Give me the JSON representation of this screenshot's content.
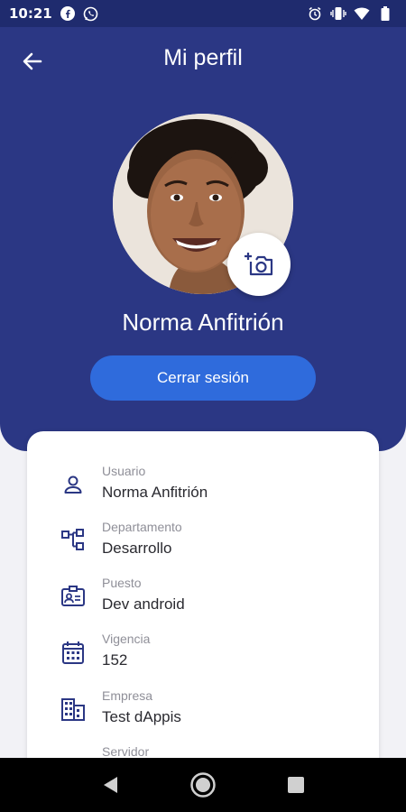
{
  "status_bar": {
    "time": "10:21",
    "left_icons": [
      "facebook-icon",
      "whatsapp-icon"
    ],
    "right_icons": [
      "alarm-icon",
      "vibrate-icon",
      "wifi-icon",
      "battery-icon"
    ]
  },
  "header": {
    "title": "Mi perfil",
    "back_icon": "arrow-left-icon",
    "background_color": "#2b3784"
  },
  "profile": {
    "name": "Norma Anfitrión",
    "logout_label": "Cerrar sesión",
    "logout_color": "#2f6bdc",
    "camera_icon": "add-photo-icon"
  },
  "info": {
    "items": [
      {
        "label": "Usuario",
        "value": "Norma Anfitrión",
        "icon": "person-icon"
      },
      {
        "label": "Departamento",
        "value": "Desarrollo",
        "icon": "hierarchy-icon"
      },
      {
        "label": "Puesto",
        "value": "Dev android",
        "icon": "badge-icon"
      },
      {
        "label": "Vigencia",
        "value": "152",
        "icon": "calendar-icon"
      },
      {
        "label": "Empresa",
        "value": "Test dAppis",
        "icon": "building-icon"
      },
      {
        "label": "Servidor",
        "value": "",
        "icon": "server-icon"
      }
    ]
  },
  "navbar": {
    "icons": [
      "back-triangle-icon",
      "home-circle-icon",
      "recents-square-icon"
    ]
  }
}
